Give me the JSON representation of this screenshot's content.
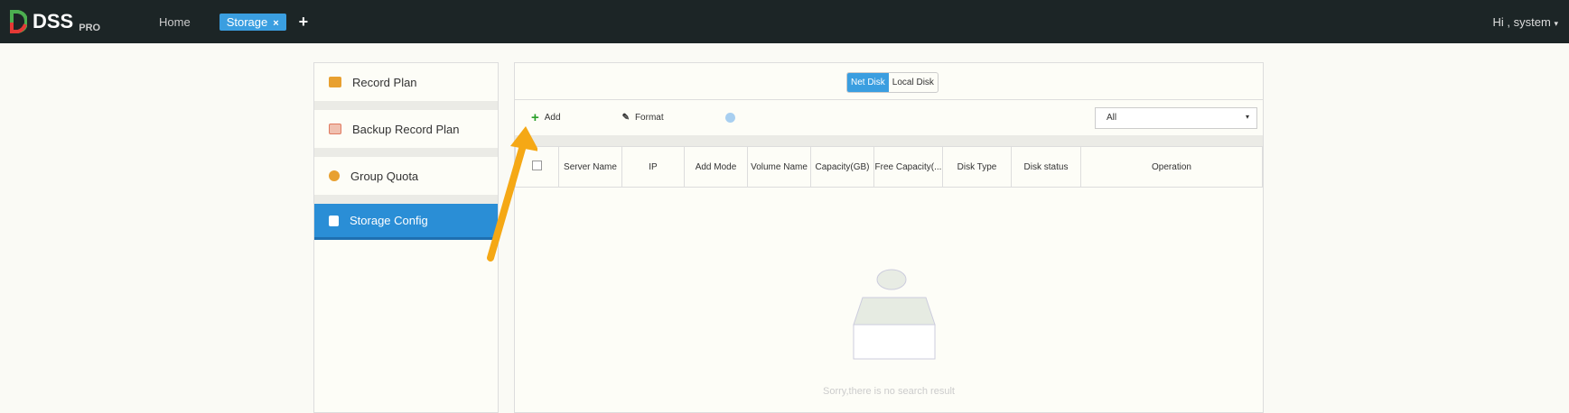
{
  "header": {
    "brand": "DSS",
    "brand_sup": "PRO",
    "home": "Home",
    "tab": "Storage",
    "tab_close": "×",
    "add_tab": "+",
    "user": "Hi , system",
    "user_caret": "▾"
  },
  "sidebar": {
    "items": [
      {
        "label": "Record Plan",
        "color": "#e8a030"
      },
      {
        "label": "Backup Record Plan",
        "color": "#e07a60"
      },
      {
        "label": "Group Quota",
        "color": "#e8a030"
      },
      {
        "label": "Storage Config",
        "color": "#ffffff"
      }
    ]
  },
  "main": {
    "seg": [
      "Net Disk",
      "Local Disk"
    ],
    "add": "Add",
    "format": "Format",
    "filter": "All",
    "filter_caret": "▾",
    "columns": [
      "Server Name",
      "IP",
      "Add Mode",
      "Volume Name",
      "Capacity(GB)",
      "Free Capacity(...",
      "Disk Type",
      "Disk status",
      "Operation"
    ],
    "empty": "Sorry,there is no search result"
  },
  "colors": {
    "accent": "#3a9ee0",
    "annotation": "#f5a815"
  }
}
